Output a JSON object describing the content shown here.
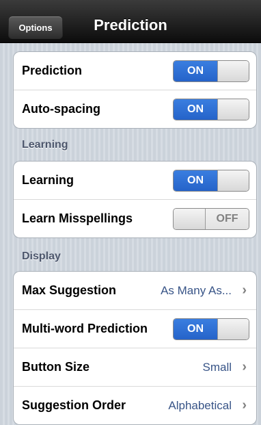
{
  "navbar": {
    "back_label": "Options",
    "title": "Prediction"
  },
  "group1": {
    "rows": [
      {
        "label": "Prediction",
        "toggle": "ON"
      },
      {
        "label": "Auto-spacing",
        "toggle": "ON"
      }
    ]
  },
  "learning_section": {
    "header": "Learning",
    "rows": [
      {
        "label": "Learning",
        "toggle": "ON"
      },
      {
        "label": "Learn Misspellings",
        "toggle": "OFF"
      }
    ]
  },
  "display_section": {
    "header": "Display",
    "rows": [
      {
        "label": "Max Suggestion",
        "value": "As Many As..."
      },
      {
        "label": "Multi-word Prediction",
        "toggle": "ON"
      },
      {
        "label": "Button Size",
        "value": "Small"
      },
      {
        "label": "Suggestion Order",
        "value": "Alphabetical"
      }
    ]
  },
  "colors": {
    "toggle_on": "#2f72d6",
    "value_text": "#385487",
    "section_header": "#4c566c"
  }
}
